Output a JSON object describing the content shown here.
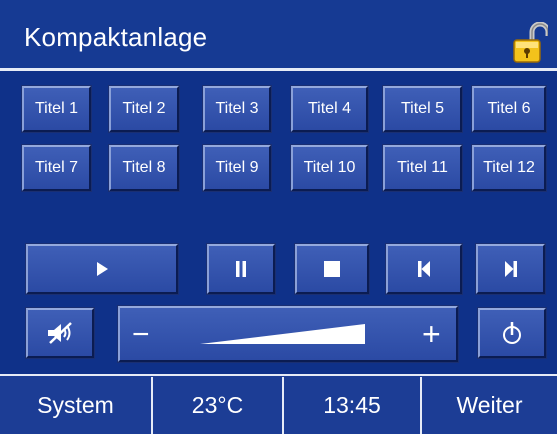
{
  "header": {
    "title": "Kompaktanlage",
    "lock_icon": "unlocked-padlock-icon"
  },
  "titles": [
    "Titel 1",
    "Titel 2",
    "Titel 3",
    "Titel 4",
    "Titel 5",
    "Titel 6",
    "Titel 7",
    "Titel 8",
    "Titel 9",
    "Titel 10",
    "Titel 11",
    "Titel 12"
  ],
  "controls": {
    "play_icon": "play-icon",
    "pause_icon": "pause-icon",
    "stop_icon": "stop-icon",
    "previous_icon": "skip-previous-icon",
    "next_icon": "skip-next-icon",
    "mute_icon": "mute-icon",
    "power_icon": "power-icon"
  },
  "volume": {
    "minus_label": "−",
    "plus_label": "+",
    "level_icon": "volume-ramp-icon"
  },
  "footer": {
    "system": "System",
    "temperature": "23°C",
    "time": "13:45",
    "next": "Weiter"
  },
  "colors": {
    "background": "#0f3189",
    "button": "#3452ab",
    "text": "#ffffff",
    "divider": "#e6ebf6"
  }
}
